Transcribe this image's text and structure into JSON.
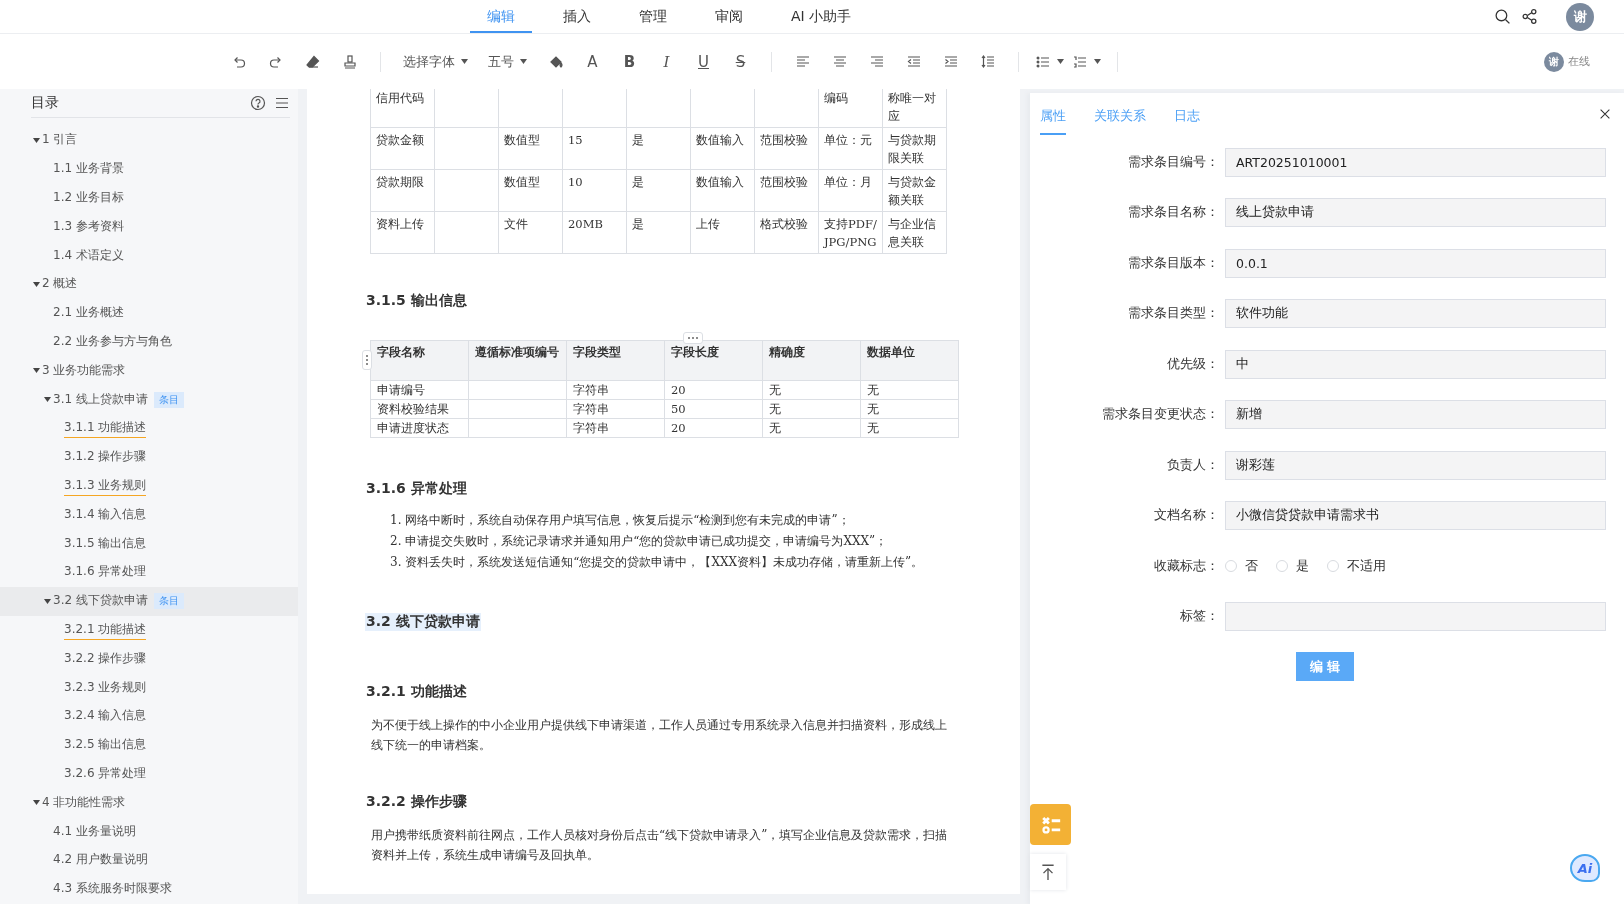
{
  "top_tabs": [
    {
      "label": "编辑",
      "selected": true
    },
    {
      "label": "插入",
      "selected": false
    },
    {
      "label": "管理",
      "selected": false
    },
    {
      "label": "审阅",
      "selected": false
    },
    {
      "label": "AI 小助手",
      "selected": false
    }
  ],
  "user_avatar": "谢",
  "toolbar": {
    "groups": [
      [
        {
          "kind": "undo"
        },
        {
          "kind": "redo"
        },
        {
          "kind": "eraser"
        },
        {
          "kind": "painter"
        }
      ],
      [
        {
          "kind": "dropdown",
          "label": "选择字体"
        },
        {
          "kind": "dropdown",
          "label": "五号"
        },
        {
          "kind": "fill"
        },
        {
          "kind": "font-color",
          "label": "A"
        },
        {
          "kind": "bold",
          "label": "B"
        },
        {
          "kind": "italic",
          "label": "I"
        },
        {
          "kind": "underline",
          "label": "U"
        },
        {
          "kind": "strike",
          "label": "S"
        }
      ],
      [
        {
          "kind": "align-left"
        },
        {
          "kind": "align-center"
        },
        {
          "kind": "align-right"
        },
        {
          "kind": "outdent"
        },
        {
          "kind": "indent"
        },
        {
          "kind": "line-height"
        }
      ],
      [
        {
          "kind": "bullets"
        },
        {
          "kind": "numbering"
        }
      ]
    ]
  },
  "presence": {
    "avatar": "谢",
    "label": "在线"
  },
  "sidebar": {
    "title": "目录",
    "tree": [
      {
        "label": "1 引言",
        "expanded": true,
        "selected": false,
        "flagged": false,
        "children": [
          {
            "label": "1.1 业务背景",
            "selected": false,
            "flagged": false
          },
          {
            "label": "1.2 业务目标",
            "selected": false,
            "flagged": false
          },
          {
            "label": "1.3 参考资料",
            "selected": false,
            "flagged": false
          },
          {
            "label": "1.4 术语定义",
            "selected": false,
            "flagged": false
          }
        ]
      },
      {
        "label": "2 概述",
        "expanded": true,
        "selected": false,
        "flagged": false,
        "children": [
          {
            "label": "2.1 业务概述",
            "selected": false,
            "flagged": false
          },
          {
            "label": "2.2 业务参与方与角色",
            "selected": false,
            "flagged": false
          }
        ]
      },
      {
        "label": "3 业务功能需求",
        "expanded": true,
        "selected": false,
        "flagged": false,
        "children": [
          {
            "label": "3.1 线上贷款申请",
            "badge": "条目",
            "expanded": true,
            "selected": false,
            "flagged": false,
            "children": [
              {
                "label": "3.1.1 功能描述",
                "selected": false,
                "flagged": true
              },
              {
                "label": "3.1.2 操作步骤",
                "selected": false,
                "flagged": false
              },
              {
                "label": "3.1.3 业务规则",
                "selected": false,
                "flagged": true
              },
              {
                "label": "3.1.4 输入信息",
                "selected": false,
                "flagged": false
              },
              {
                "label": "3.1.5 输出信息",
                "selected": false,
                "flagged": false
              },
              {
                "label": "3.1.6 异常处理",
                "selected": false,
                "flagged": false
              }
            ]
          },
          {
            "label": "3.2 线下贷款申请",
            "badge": "条目",
            "expanded": true,
            "selected": true,
            "flagged": false,
            "children": [
              {
                "label": "3.2.1 功能描述",
                "selected": false,
                "flagged": true
              },
              {
                "label": "3.2.2 操作步骤",
                "selected": false,
                "flagged": false
              },
              {
                "label": "3.2.3 业务规则",
                "selected": false,
                "flagged": false
              },
              {
                "label": "3.2.4 输入信息",
                "selected": false,
                "flagged": false
              },
              {
                "label": "3.2.5 输出信息",
                "selected": false,
                "flagged": false
              },
              {
                "label": "3.2.6 异常处理",
                "selected": false,
                "flagged": false
              }
            ]
          }
        ]
      },
      {
        "label": "4 非功能性需求",
        "expanded": true,
        "selected": false,
        "flagged": false,
        "children": [
          {
            "label": "4.1 业务量说明",
            "selected": false,
            "flagged": false
          },
          {
            "label": "4.2 用户数量说明",
            "selected": false,
            "flagged": false
          },
          {
            "label": "4.3 系统服务时限要求",
            "selected": false,
            "flagged": false
          }
        ]
      }
    ]
  },
  "document": {
    "blocks": [
      {
        "kind": "table",
        "rows": [
          [
            "信用代码",
            "",
            "",
            "",
            "",
            "",
            "",
            "编码",
            "称唯一对应"
          ],
          [
            "贷款金额",
            "",
            "数值型",
            "15",
            "是",
            "数值输入",
            "范围校验",
            "单位：元",
            "与贷款期限关联"
          ],
          [
            "贷款期限",
            "",
            "数值型",
            "10",
            "是",
            "数值输入",
            "范围校验",
            "单位：月",
            "与贷款金额关联"
          ],
          [
            "资料上传",
            "",
            "文件",
            "20MB",
            "是",
            "上传",
            "格式校验",
            "支持PDF/JPG/PNG",
            "与企业信息关联"
          ]
        ]
      },
      {
        "kind": "heading",
        "text": "3.1.5 输出信息",
        "highlighted": false
      },
      {
        "kind": "table",
        "columns": [
          "字段名称",
          "遵循标准项编号",
          "字段类型",
          "字段长度",
          "精确度",
          "数据单位"
        ],
        "rows": [
          [
            "申请编号",
            "",
            "字符串",
            "20",
            "无",
            "无"
          ],
          [
            "资料校验结果",
            "",
            "字符串",
            "50",
            "无",
            "无"
          ],
          [
            "申请进度状态",
            "",
            "字符串",
            "20",
            "无",
            "无"
          ]
        ]
      },
      {
        "kind": "heading",
        "text": "3.1.6 异常处理",
        "highlighted": false
      },
      {
        "kind": "list",
        "items": [
          {
            "number": "1.",
            "text": "网络中断时，系统自动保存用户填写信息，恢复后提示“检测到您有未完成的申请”；"
          },
          {
            "number": "2.",
            "text": "申请提交失败时，系统记录请求并通知用户“您的贷款申请已成功提交，申请编号为XXX”；"
          },
          {
            "number": "3.",
            "text": "资料丢失时，系统发送短信通知“您提交的贷款申请中，【XXX资料】未成功存储，请重新上传”。"
          }
        ]
      },
      {
        "kind": "heading",
        "text": "3.2 线下贷款申请",
        "highlighted": true
      },
      {
        "kind": "heading",
        "text": "3.2.1 功能描述",
        "highlighted": false
      },
      {
        "kind": "paragraph",
        "text": "为不便于线上操作的中小企业用户提供线下申请渠道，工作人员通过专用系统录入信息并扫描资料，形成线上线下统一的申请档案。"
      },
      {
        "kind": "heading",
        "text": "3.2.2 操作步骤",
        "highlighted": false
      },
      {
        "kind": "paragraph",
        "text": "用户携带纸质资料前往网点，工作人员核对身份后点击“线下贷款申请录入”，填写企业信息及贷款需求，扫描资料并上传，系统生成申请编号及回执单。"
      }
    ]
  },
  "panel": {
    "tabs": [
      {
        "label": "属性",
        "selected": true
      },
      {
        "label": "关联关系",
        "selected": false
      },
      {
        "label": "日志",
        "selected": false
      }
    ],
    "fields": [
      {
        "kind": "text",
        "label": "需求条目编号：",
        "value": "ART20251010001"
      },
      {
        "kind": "text",
        "label": "需求条目名称：",
        "value": "线上贷款申请"
      },
      {
        "kind": "text",
        "label": "需求条目版本：",
        "value": "0.0.1"
      },
      {
        "kind": "text",
        "label": "需求条目类型：",
        "value": "软件功能"
      },
      {
        "kind": "text",
        "label": "优先级：",
        "value": "中"
      },
      {
        "kind": "text",
        "label": "需求条目变更状态：",
        "value": "新增"
      },
      {
        "kind": "text",
        "label": "负责人：",
        "value": "谢彩莲"
      },
      {
        "kind": "text",
        "label": "文档名称：",
        "value": "小微信贷贷款申请需求书"
      },
      {
        "kind": "radio",
        "label": "收藏标志：",
        "options": [
          {
            "label": "否",
            "selected": false
          },
          {
            "label": "是",
            "selected": false
          },
          {
            "label": "不适用",
            "selected": false
          }
        ]
      },
      {
        "kind": "text",
        "label": "标签："
      }
    ],
    "button": "编 辑"
  },
  "ai_assistant": {
    "label": "Ai"
  }
}
